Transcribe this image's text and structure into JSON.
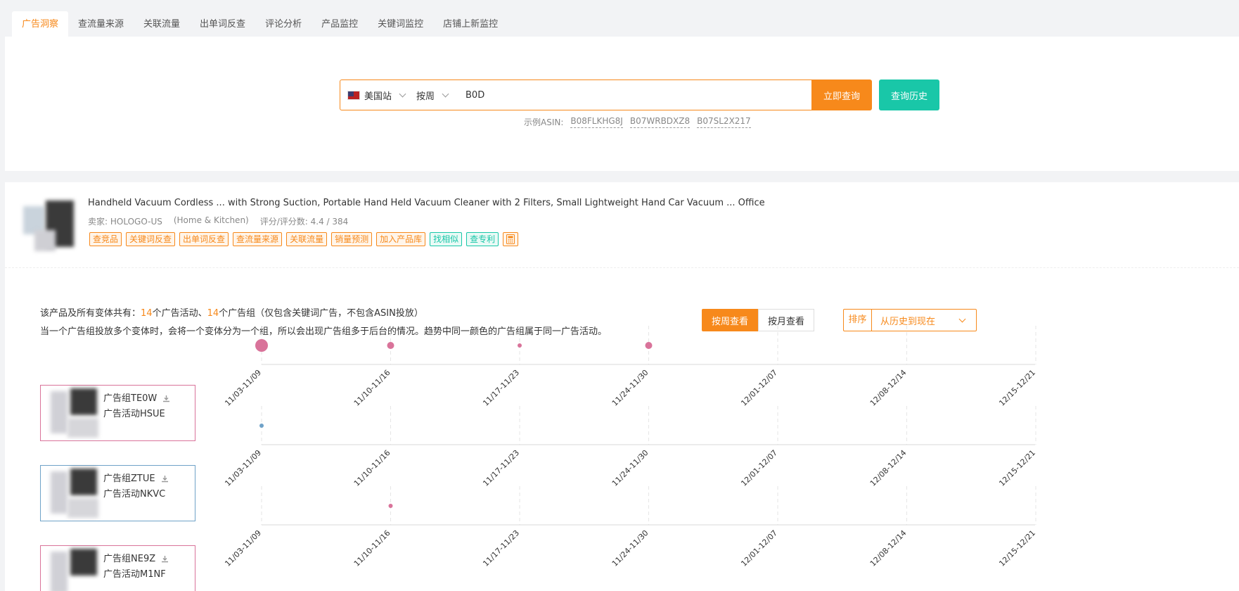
{
  "tabs": [
    "广告洞察",
    "查流量来源",
    "关联流量",
    "出单词反查",
    "评论分析",
    "产品监控",
    "关键词监控",
    "店铺上新监控"
  ],
  "search": {
    "site": "美国站",
    "period": "按周",
    "value": "B0D",
    "query_button": "立即查询",
    "history_button": "查询历史",
    "examples_label": "示例ASIN:",
    "examples": [
      "B08FLKHG8J",
      "B07WRBDXZ8",
      "B07SL2X217"
    ]
  },
  "product": {
    "title": "Handheld Vacuum Cordless ... with Strong Suction, Portable Hand Held Vacuum Cleaner with 2 Filters, Small Lightweight Hand Car Vacuum ... Office",
    "seller": "卖家: HOLOGO-US",
    "category": "(Home & Kitchen)",
    "rating": "评分/评分数: 4.4 / 384",
    "actions": [
      "查竞品",
      "关键词反查",
      "出单词反查",
      "查流量来源",
      "关联流量",
      "销量预测",
      "加入产品库"
    ],
    "actions_green": [
      "找相似",
      "查专利"
    ]
  },
  "summary": {
    "prefix": "该产品及所有变体共有：",
    "campaigns": "14",
    "campaigns_label": "个广告活动、",
    "groups": "14",
    "groups_label": "个广告组（仅包含关键词广告，不包含ASIN投放）",
    "note": "当一个广告组投放多个变体时，会将一个变体分为一个组，所以会出现广告组多于后台的情况。趋势中同一颜色的广告组属于同一广告活动。"
  },
  "view": {
    "weekly": "按周查看",
    "monthly": "按月查看",
    "sort_label": "排序",
    "sort_value": "从历史到现在"
  },
  "colors": {
    "accent": "#f7891b",
    "green": "#19c7a8",
    "pink_dot": "#d9739a",
    "blue_dot": "#6fa2c8"
  },
  "weeks": [
    "11/03-11/09",
    "11/10-11/16",
    "11/17-11/23",
    "11/24-11/30",
    "12/01-12/07",
    "12/08-12/14",
    "12/15-12/21"
  ],
  "groups": [
    {
      "group": "广告组TE0W",
      "campaign": "广告活动HSUE",
      "color": "pink",
      "dots": [
        {
          "week": 0,
          "size": "large"
        },
        {
          "week": 1,
          "size": "medium"
        },
        {
          "week": 2,
          "size": "small"
        },
        {
          "week": 3,
          "size": "medium"
        }
      ]
    },
    {
      "group": "广告组ZTUE",
      "campaign": "广告活动NKVC",
      "color": "blue",
      "dots": [
        {
          "week": 0,
          "size": "small"
        }
      ]
    },
    {
      "group": "广告组NE9Z",
      "campaign": "广告活动M1NF",
      "color": "pink",
      "dots": [
        {
          "week": 1,
          "size": "small"
        }
      ]
    }
  ]
}
